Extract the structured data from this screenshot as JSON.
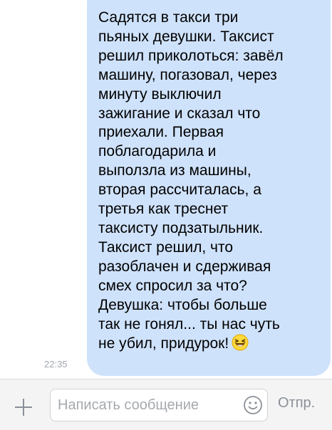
{
  "message": {
    "lines": [
      "Садятся в такси три",
      "пьяных девушки. Таксист",
      "решил приколоться: завёл",
      "машину, погазовал, через",
      "минуту выключил",
      "зажигание и сказал что",
      "приехали. Первая",
      "поблагодарила и",
      "выползла из машины,",
      "вторая рассчиталась, а",
      "третья как треснет",
      "таксисту подзатыльник.",
      "Таксист решил, что",
      "разоблачен и сдерживая",
      "смех спросил за что?",
      "Девушка: чтобы больше",
      "так не гонял... ты нас чуть",
      "не убил, придурок!"
    ],
    "timestamp": "22:35",
    "emoji_icon": "laughing-face-emoji",
    "bubble_color": "#cfe2fb"
  },
  "composer": {
    "add_icon": "plus-icon",
    "input_placeholder": "Написать сообщение",
    "input_value": "",
    "emoji_icon": "smile-icon",
    "send_label": "Отпр."
  }
}
